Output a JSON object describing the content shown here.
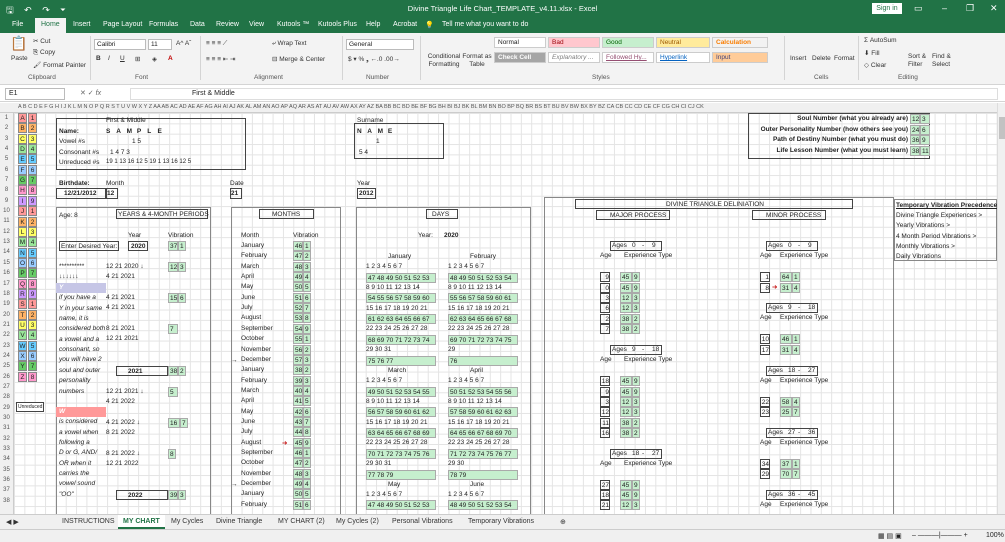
{
  "window": {
    "title": "Divine Triangle Life Chart_TEMPLATE_v4.11.xlsx - Excel",
    "sign_in": "Sign in"
  },
  "ribbon_tabs": [
    "File",
    "Home",
    "Insert",
    "Page Layout",
    "Formulas",
    "Data",
    "Review",
    "View",
    "Kutools ™",
    "Kutools Plus",
    "Help",
    "Acrobat"
  ],
  "tell_me": "Tell me what you want to do",
  "ribbon": {
    "paste": "Paste",
    "cut": "Cut",
    "copy": "Copy",
    "format_painter": "Format Painter",
    "clipboard": "Clipboard",
    "font_name": "Calibri",
    "font_size": "11",
    "font_group": "Font",
    "wrap_text": "Wrap Text",
    "merge_center": "Merge & Center",
    "alignment": "Alignment",
    "number_format": "General",
    "number": "Number",
    "conditional": "Conditional Formatting",
    "format_as_table": "Format as Table",
    "styles": "Styles",
    "style_normal": "Normal",
    "style_bad": "Bad",
    "style_good": "Good",
    "style_neutral": "Neutral",
    "style_calculation": "Calculation",
    "style_check_cell": "Check Cell",
    "style_explanatory": "Explanatory ...",
    "style_followed": "Followed Hy...",
    "style_hyperlink": "Hyperlink",
    "style_input": "Input",
    "insert": "Insert",
    "delete": "Delete",
    "format": "Format",
    "cells": "Cells",
    "autosum": "AutoSum",
    "fill": "Fill",
    "clear": "Clear",
    "sort_filter": "Sort & Filter",
    "find_select": "Find & Select",
    "editing": "Editing"
  },
  "formula_bar": {
    "name_box": "E1",
    "fx": "fx",
    "content": "First & Middle"
  },
  "columns": "A B C D E F G H I J K L M N O P Q R S T U V W X Y Z AA AB AC AD AE AF AG AH AI AJ AK AL AM AN AO AP AQ AR AS AT AU AV AW AX AY AZ BA BB BC BD BE BF BG BH BI BJ BK BL BM BN BO BP BQ BR BS BT BU BV BW BX BY BZ CA CB CC CD CE CF CG CH CI CJ CK",
  "rows": [
    "1",
    "2",
    "3",
    "4",
    "5",
    "6",
    "7",
    "8",
    "9",
    "10",
    "11",
    "12",
    "13",
    "14",
    "15",
    "16",
    "17",
    "18",
    "19",
    "20",
    "21",
    "22",
    "23",
    "24",
    "25",
    "26",
    "27",
    "28",
    "29",
    "30",
    "31",
    "32",
    "33",
    "34",
    "35",
    "36",
    "37",
    "38"
  ],
  "alphabet": [
    [
      "A",
      "1"
    ],
    [
      "B",
      "2"
    ],
    [
      "C",
      "3"
    ],
    [
      "D",
      "4"
    ],
    [
      "E",
      "5"
    ],
    [
      "F",
      "6"
    ],
    [
      "G",
      "7"
    ],
    [
      "H",
      "8"
    ],
    [
      "I",
      "9"
    ],
    [
      "J",
      "1"
    ],
    [
      "K",
      "2"
    ],
    [
      "L",
      "3"
    ],
    [
      "M",
      "4"
    ],
    [
      "N",
      "5"
    ],
    [
      "O",
      "6"
    ],
    [
      "P",
      "7"
    ],
    [
      "Q",
      "8"
    ],
    [
      "R",
      "9"
    ],
    [
      "S",
      "1"
    ],
    [
      "T",
      "2"
    ],
    [
      "U",
      "3"
    ],
    [
      "V",
      "4"
    ],
    [
      "W",
      "5"
    ],
    [
      "X",
      "6"
    ],
    [
      "Y",
      "7"
    ],
    [
      "Z",
      "8"
    ]
  ],
  "unreduced": "Unreduced",
  "name_table": {
    "first_middle": "First & Middle",
    "surname": "Surname",
    "name_label": "Name:",
    "vowel_label": "Vowel #s",
    "consonant_label": "Consonant #s",
    "unreduced_label": "Unreduced #s",
    "letters": [
      "S",
      "A",
      "M",
      "P",
      "L",
      "E"
    ],
    "surname_letters": [
      "N",
      "A",
      "M",
      "E"
    ],
    "vowel_nums": "1      5",
    "consonant_nums": "1    4  7  3",
    "unreduced_nums": "19  1  13 16 12  5  19  1  13 16 12  5",
    "s_vowel": "1",
    "s_consonant": "5    4"
  },
  "birth": {
    "label": "Birthdate:",
    "value": "12/21/2012",
    "month_label": "Month",
    "month": "12",
    "date_label": "Date",
    "date": "21",
    "year_label": "Year",
    "year": "2012"
  },
  "core_numbers": [
    {
      "label": "Soul Number (what you already are)",
      "a": "12",
      "b": "3"
    },
    {
      "label": "Outer Personality Number (how others see you)",
      "a": "24",
      "b": "6"
    },
    {
      "label": "Path of Destiny Number (what you must do)",
      "a": "36",
      "b": "9"
    },
    {
      "label": "Life Lesson Number (what you must learn)",
      "a": "38",
      "b": "11"
    }
  ],
  "age_block": {
    "age": "Age: 8",
    "title": "YEARS & 4-MONTH PERIODS",
    "year_h": "Year",
    "vib_h": "Vibration",
    "enter_year": "Enter Desired Year:",
    "year_val": "2020",
    "year_vib": "37",
    "year_vib2": "1",
    "stars": "**********",
    "arrows": "↓↓↓↓↓↓",
    "r1": "4  21  2021",
    "r2": "4  21  2021",
    "r3": "8  21  2021",
    "r4": "12  21  2021",
    "top": "12  21  2020 ↓",
    "vib1": "12",
    "vib1b": "3",
    "vib2": "15",
    "vib2b": "6",
    "vib3": "7",
    "y2021": "2021",
    "y2021v": "38",
    "y2021v2": "2",
    "v5": "5",
    "rA": "12  21  2021 ↓",
    "rB": "4  21  2022",
    "rC": "4  21  2022 ↓",
    "rD": "8  21  2022",
    "rE": "8  21  2022 ↓",
    "rF": "12  21  2022",
    "v16": "16",
    "v7": "7",
    "v8": "8",
    "y2022": "2022",
    "y2022v": "39",
    "y2022v2": "3",
    "note_y": [
      "Y",
      "if you have a",
      "Y in your same",
      "name, it is",
      "considered both",
      "a vowel and a",
      "consonant, so",
      "you will have 2",
      "soul and outer",
      "personality",
      "numbers"
    ],
    "note_w": [
      "W",
      "is considered",
      "a vowel when",
      "following a",
      "D or G, AND/",
      "OR when it",
      "carries the",
      "vowel sound",
      "\"OO\""
    ]
  },
  "months_block": {
    "title": "MONTHS",
    "month_h": "Month",
    "vib_h": "Vibration",
    "months": [
      [
        "January",
        "46",
        "1"
      ],
      [
        "February",
        "47",
        "2"
      ],
      [
        "March",
        "48",
        "3"
      ],
      [
        "April",
        "49",
        "4"
      ],
      [
        "May",
        "50",
        "5"
      ],
      [
        "June",
        "51",
        "6"
      ],
      [
        "July",
        "52",
        "7"
      ],
      [
        "August",
        "53",
        "8"
      ],
      [
        "September",
        "54",
        "9"
      ],
      [
        "October",
        "55",
        "1"
      ],
      [
        "November",
        "56",
        "2"
      ],
      [
        "December",
        "57",
        "3"
      ],
      [
        "January",
        "38",
        "2"
      ],
      [
        "February",
        "39",
        "3"
      ],
      [
        "March",
        "40",
        "4"
      ],
      [
        "April",
        "41",
        "5"
      ],
      [
        "May",
        "42",
        "6"
      ],
      [
        "June",
        "43",
        "7"
      ],
      [
        "July",
        "44",
        "8"
      ],
      [
        "August",
        "45",
        "9"
      ],
      [
        "September",
        "46",
        "1"
      ],
      [
        "October",
        "47",
        "2"
      ],
      [
        "November",
        "48",
        "3"
      ],
      [
        "December",
        "49",
        "4"
      ],
      [
        "January",
        "50",
        "5"
      ],
      [
        "February",
        "51",
        "6"
      ]
    ]
  },
  "days_block": {
    "title": "DAYS",
    "year_label": "Year:",
    "year": "2020",
    "m1": "January",
    "m2": "February",
    "m3": "March",
    "m4": "April",
    "m5": "May",
    "m6": "June",
    "week": "1  2  3  4  5  6  7",
    "rows_a": [
      "8  9  10 11 12 13 14",
      "15 16 17 18 19 20 21",
      "22 23 24 25 26 27 28",
      "29 30 31"
    ],
    "rows_b": [
      "8  9  10 11 12 13 14",
      "15 16 17 18 19 20 21",
      "22 23 24 25 26 27 28",
      "29"
    ],
    "rows_c": [
      "8  9  10 11 12 13 14",
      "15 16 17 18 19 20 21",
      "22 23 24 25 26 27 28",
      "29 30 31"
    ],
    "rows_d": [
      "8  9  10 11 12 13 14",
      "15 16 17 18 19 20 21",
      "22 23 24 25 26 27 28",
      "29 30"
    ],
    "g1": "47 48 49 50 51 52 53",
    "g2": "54 55 56 57 58 59 60",
    "g3": "61 62 63 64 65 66 67",
    "g4": "68 69 70 71 72 73 74",
    "g5": "75 76 77",
    "h1": "48 49 50 51 52 53 54",
    "h2": "55 56 57 58 59 60 61",
    "h3": "62 63 64 65 66 67 68",
    "h4": "69 70 71 72 73 74 75",
    "h5": "76",
    "i1": "49 50 51 52 53 54 55",
    "i2": "56 57 58 59 60 61 62",
    "i3": "63 64 65 66 67 68 69",
    "i4": "70 71 72 73 74 75 76",
    "i5": "77 78 79",
    "j1": "50 51 52 53 54 55 56",
    "j2": "57 58 59 60 61 62 63",
    "j3": "64 65 66 67 68 69 70",
    "j4": "71 72 73 74 75 76 77",
    "j5": "78 79"
  },
  "delineation": {
    "title": "DIVINE TRIANGLE DELINIATION",
    "major": "MAJOR PROCESS",
    "minor": "MINOR PROCESS",
    "ages_lbl": "Ages",
    "age_h": "Age",
    "exp_h": "Experience Type",
    "maj_ages": [
      [
        "0",
        "9"
      ],
      [
        "9",
        "18"
      ],
      [
        "18",
        "27"
      ]
    ],
    "maj_rows": [
      [
        "9",
        "45",
        "9"
      ],
      [
        "0",
        "45",
        "9"
      ],
      [
        "3",
        "12",
        "3"
      ],
      [
        "6",
        "12",
        "3"
      ],
      [
        "2",
        "38",
        "2"
      ],
      [
        "7",
        "38",
        "2"
      ],
      [
        "18",
        "45",
        "9"
      ],
      [
        "9",
        "45",
        "9"
      ],
      [
        "3",
        "12",
        "3"
      ],
      [
        "12",
        "12",
        "3"
      ],
      [
        "11",
        "38",
        "2"
      ],
      [
        "16",
        "38",
        "2"
      ],
      [
        "27",
        "45",
        "9"
      ],
      [
        "18",
        "45",
        "9"
      ],
      [
        "21",
        "12",
        "3"
      ]
    ],
    "min_ages": [
      [
        "0",
        "9"
      ],
      [
        "9",
        "18"
      ],
      [
        "18",
        "27"
      ],
      [
        "27",
        "36"
      ],
      [
        "36",
        "45"
      ]
    ],
    "min_rows": [
      [
        "1",
        "64",
        "1"
      ],
      [
        "8",
        "31",
        "4"
      ],
      [
        "10",
        "46",
        "1"
      ],
      [
        "17",
        "31",
        "4"
      ],
      [
        "22",
        "58",
        "4"
      ],
      [
        "23",
        "25",
        "7"
      ],
      [
        "34",
        "37",
        "1"
      ],
      [
        "29",
        "70",
        "7"
      ]
    ]
  },
  "vibration_links": {
    "title": "Temporary Vibration Precedence",
    "items": [
      "Divine Triangle Experiences >",
      "Yearly Vibrations >",
      "4 Month Period Vibrations >",
      "Monthly Vibrations >",
      "Daily Vibrations"
    ]
  },
  "sheet_tabs": [
    "INSTRUCTIONS",
    "MY CHART",
    "My Cycles",
    "Divine Triangle",
    "MY CHART (2)",
    "My Cycles (2)",
    "Personal Vibrations",
    "Temporary Vibrations"
  ],
  "status": {
    "zoom": "100%"
  },
  "colors": {
    "excel_green": "#217346",
    "good": "#c6efce",
    "bad": "#ffc7ce",
    "neutral": "#ffeb9c",
    "pink": "#ff9999"
  }
}
